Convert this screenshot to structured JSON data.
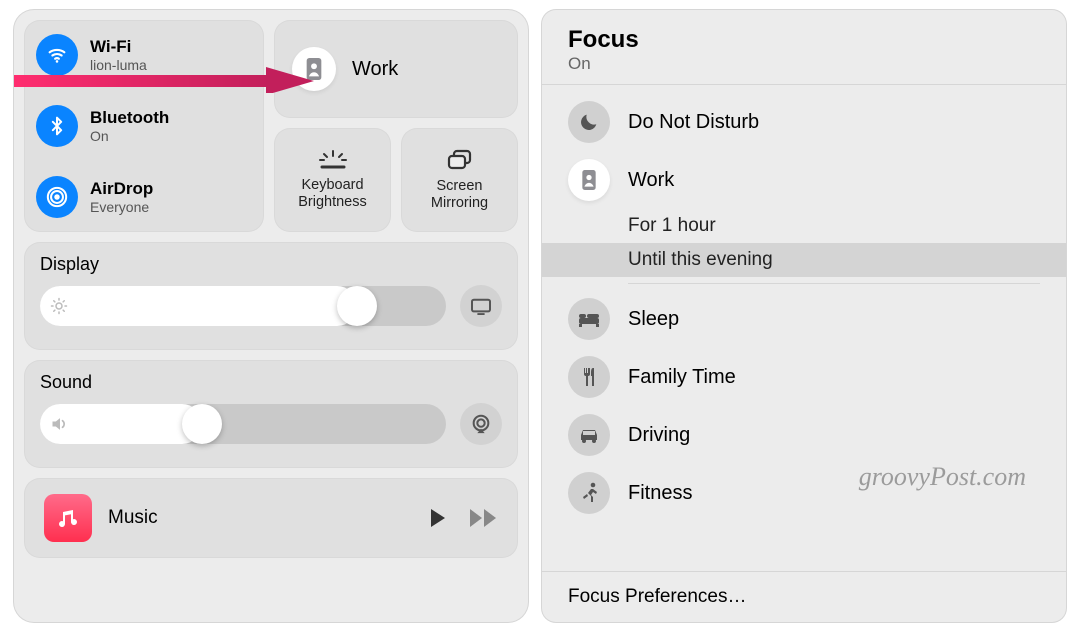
{
  "control_center": {
    "wifi": {
      "label": "Wi-Fi",
      "sub": "lion-luma"
    },
    "bluetooth": {
      "label": "Bluetooth",
      "sub": "On"
    },
    "airdrop": {
      "label": "AirDrop",
      "sub": "Everyone"
    },
    "focus": {
      "label": "Work"
    },
    "keyboard_brightness_label": "Keyboard Brightness",
    "screen_mirroring_label": "Screen Mirroring",
    "display": {
      "title": "Display",
      "value_pct": 78
    },
    "sound": {
      "title": "Sound",
      "value_pct": 40
    },
    "music": {
      "title": "Music"
    }
  },
  "focus_panel": {
    "title": "Focus",
    "state": "On",
    "modes": {
      "dnd": "Do Not Disturb",
      "work": "Work",
      "sleep": "Sleep",
      "family": "Family Time",
      "driving": "Driving",
      "fitness": "Fitness"
    },
    "work_durations": {
      "one_hour": "For 1 hour",
      "evening": "Until this evening"
    },
    "preferences": "Focus Preferences…"
  },
  "watermark": "groovyPost.com"
}
